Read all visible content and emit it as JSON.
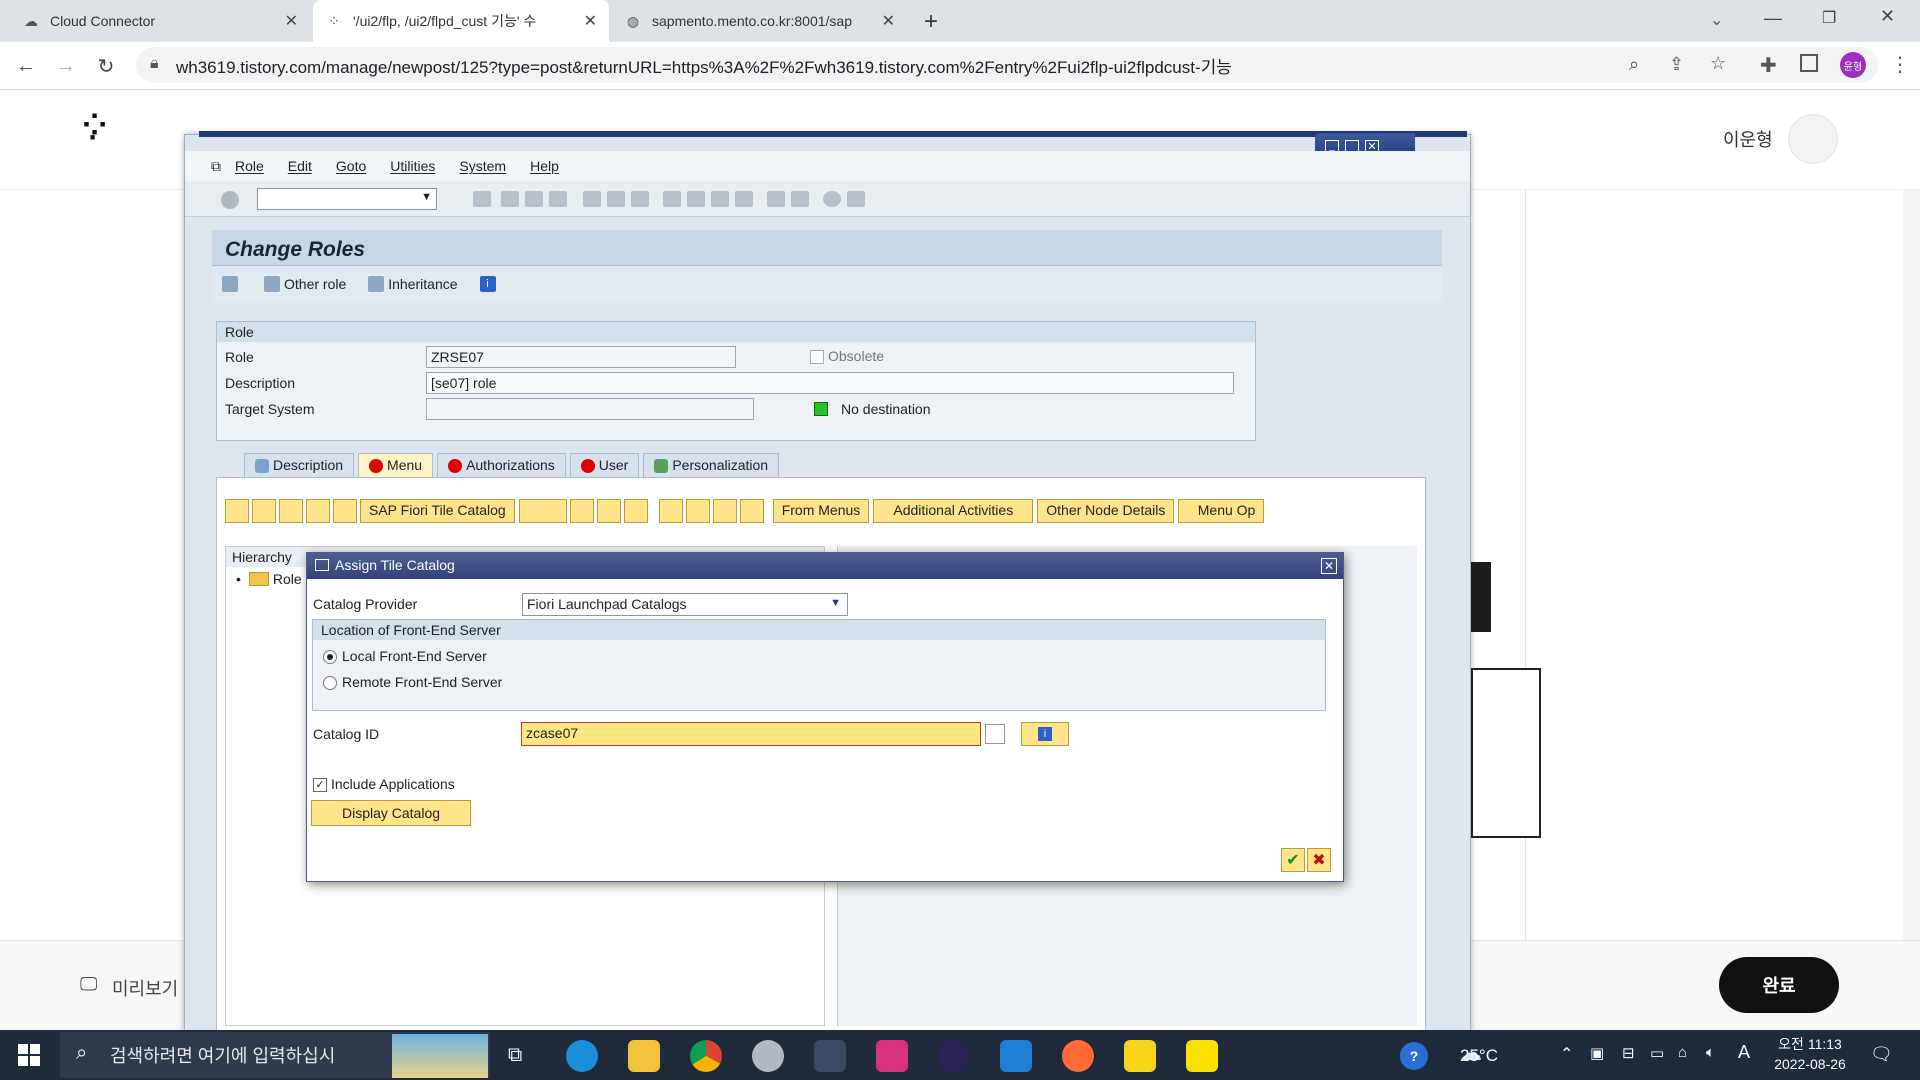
{
  "browser": {
    "tabs": [
      {
        "label": "Cloud Connector",
        "icon": "cloud-icon"
      },
      {
        "label": "'/ui2/flp, /ui2/flpd_cust 기능' 수",
        "icon": "tistory-icon"
      },
      {
        "label": "sapmento.mento.co.kr:8001/sap",
        "icon": "globe-icon"
      }
    ],
    "new_tab": "+",
    "url": "wh3619.tistory.com/manage/newpost/125?type=post&returnURL=https%3A%2F%2Fwh3619.tistory.com%2Fentry%2Fui2flp-ui2flpdcust-기능",
    "profile": "윤형"
  },
  "tistory": {
    "user_name": "이운형",
    "preview_label": "미리보기",
    "done_label": "완료"
  },
  "sap": {
    "menu": [
      "Role",
      "Edit",
      "Goto",
      "Utilities",
      "System",
      "Help"
    ],
    "title": "Change Roles",
    "app_toolbar": {
      "other_role": "Other role",
      "inheritance": "Inheritance"
    },
    "role_group": {
      "header": "Role",
      "role_label": "Role",
      "role_value": "ZRSE07",
      "obsolete_label": "Obsolete",
      "description_label": "Description",
      "description_value": "[se07] role",
      "target_label": "Target System",
      "target_value": "",
      "destination_status": "No destination"
    },
    "tabs": [
      "Description",
      "Menu",
      "Authorizations",
      "User",
      "Personalization"
    ],
    "menu_toolbar": {
      "fiori_tile_catalog": "SAP Fiori Tile Catalog",
      "from_menus": "From Menus",
      "additional_activities": "Additional Activities",
      "other_node_details": "Other Node Details",
      "menu_options": "Menu Op"
    },
    "hierarchy": {
      "header": "Hierarchy",
      "root": "Role"
    }
  },
  "dialog": {
    "title": "Assign Tile Catalog",
    "catalog_provider_label": "Catalog Provider",
    "catalog_provider_value": "Fiori Launchpad Catalogs",
    "location_header": "Location of Front-End Server",
    "local_server": "Local Front-End Server",
    "remote_server": "Remote Front-End Server",
    "catalog_id_label": "Catalog ID",
    "catalog_id_value": "zcase07",
    "include_applications": "Include Applications",
    "display_catalog": "Display Catalog"
  },
  "taskbar": {
    "search_placeholder": "검색하려면 여기에 입력하십시",
    "temperature": "25°C",
    "time": "오전 11:13",
    "date": "2022-08-26",
    "ime": "A"
  }
}
